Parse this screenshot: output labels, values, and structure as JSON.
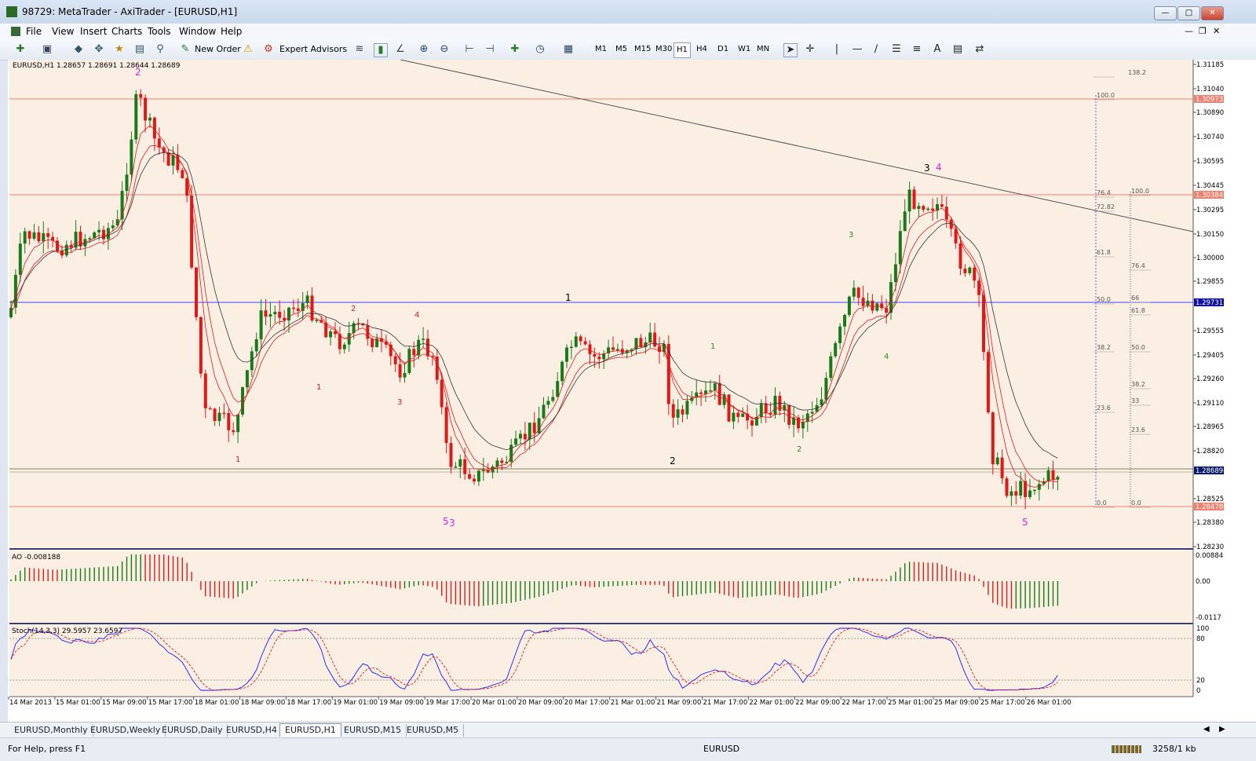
{
  "window": {
    "title": "98729: MetaTrader - AxiTrader - [EURUSD,H1]"
  },
  "menu": [
    "File",
    "View",
    "Insert",
    "Charts",
    "Tools",
    "Window",
    "Help"
  ],
  "toolbar": {
    "new_order": "New Order",
    "expert_advisors": "Expert Advisors",
    "timeframes": [
      "M1",
      "M5",
      "M15",
      "M30",
      "H1",
      "H4",
      "D1",
      "W1",
      "MN"
    ],
    "active_timeframe": "H1"
  },
  "chart": {
    "header": "EURUSD,H1  1.28657 1.28691 1.28644 1.28689",
    "price_ticks": [
      "1.31185",
      "1.31040",
      "1.30890",
      "1.30740",
      "1.30595",
      "1.30445",
      "1.30295",
      "1.30150",
      "1.30000",
      "1.29855",
      "1.29555",
      "1.29405",
      "1.29260",
      "1.29110",
      "1.28965",
      "1.28820",
      "1.28525",
      "1.28380",
      "1.28230"
    ],
    "price_labels": {
      "red_top": "1.30973",
      "red_mid": "1.30384",
      "blue": "1.29731",
      "current": "1.28689",
      "red_low": "1.28478"
    },
    "time_labels": [
      "14 Mar 2013",
      "15 Mar 01:00",
      "15 Mar 09:00",
      "15 Mar 17:00",
      "18 Mar 01:00",
      "18 Mar 09:00",
      "18 Mar 17:00",
      "19 Mar 01:00",
      "19 Mar 09:00",
      "19 Mar 17:00",
      "20 Mar 01:00",
      "20 Mar 09:00",
      "20 Mar 17:00",
      "21 Mar 01:00",
      "21 Mar 09:00",
      "21 Mar 17:00",
      "22 Mar 01:00",
      "22 Mar 09:00",
      "22 Mar 17:00",
      "25 Mar 01:00",
      "25 Mar 09:00",
      "25 Mar 17:00",
      "26 Mar 01:00"
    ],
    "fib1": [
      "138.2",
      "100.0",
      "76.4",
      "72.82",
      "61.8",
      "50.0",
      "38.2",
      "23.6",
      "0.0"
    ],
    "fib2": [
      "100.0",
      "76.4",
      "66",
      "61.8",
      "50.0",
      "38.2",
      "33",
      "23.6",
      "0.0"
    ],
    "wave_labels": [
      {
        "t": "2",
        "c": "#e020e0"
      },
      {
        "t": "1",
        "c": "#d02020"
      },
      {
        "t": "1",
        "c": "#d02020"
      },
      {
        "t": "2",
        "c": "#d02020"
      },
      {
        "t": "3",
        "c": "#d02020"
      },
      {
        "t": "4",
        "c": "#d02020"
      },
      {
        "t": "5",
        "c": "#e020e0"
      },
      {
        "t": "3",
        "c": "#e020e0"
      },
      {
        "t": "1",
        "c": "#000000"
      },
      {
        "t": "2",
        "c": "#000000"
      },
      {
        "t": "1",
        "c": "#2a8a2a"
      },
      {
        "t": "2",
        "c": "#2a8a2a"
      },
      {
        "t": "3",
        "c": "#2a8a2a"
      },
      {
        "t": "4",
        "c": "#2a8a2a"
      },
      {
        "t": "3",
        "c": "#000000"
      },
      {
        "t": "4",
        "c": "#e020e0"
      },
      {
        "t": "5",
        "c": "#e020e0"
      }
    ]
  },
  "ao": {
    "label": "AO -0.008188",
    "ticks": [
      "0.00884",
      "0.00",
      "-0.0117"
    ]
  },
  "stoch": {
    "label": "Stoch(14,3,3) 29.5957 23.6597",
    "ticks": [
      "100",
      "80",
      "20",
      "0"
    ]
  },
  "tabs": [
    "EURUSD,Monthly",
    "EURUSD,Weekly",
    "EURUSD,Daily",
    "EURUSD,H4",
    "EURUSD,H1",
    "EURUSD,M15",
    "EURUSD,M5"
  ],
  "active_tab": "EURUSD,H1",
  "status": {
    "help": "For Help, press F1",
    "symbol": "EURUSD",
    "traffic": "3258/1 kb"
  },
  "colors": {
    "bg": "#fbefe3",
    "bull": "#1a7a1a",
    "bear": "#e01818",
    "hline_red": "#f08070",
    "hline_blue": "#4040ff"
  }
}
